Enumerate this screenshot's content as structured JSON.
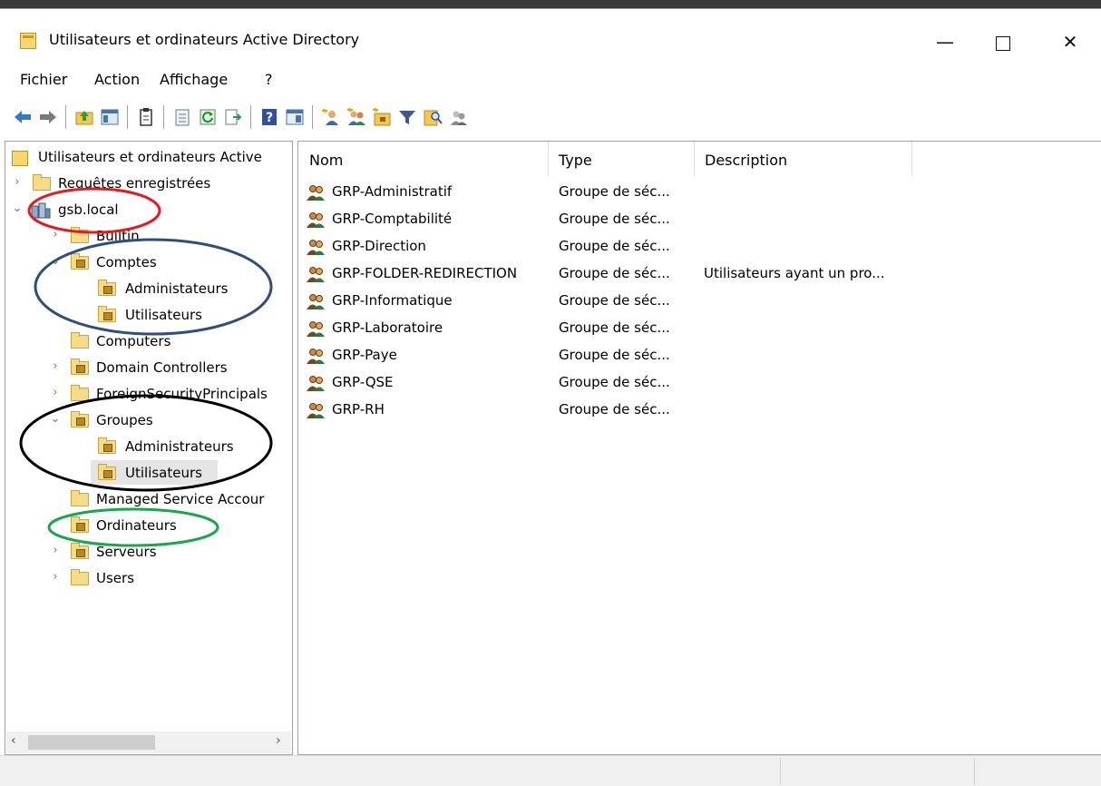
{
  "window": {
    "title": "Utilisateurs et ordinateurs Active Directory",
    "controls": {
      "minimize": "—",
      "close": "✕"
    }
  },
  "menu": [
    "Fichier",
    "Action",
    "Affichage",
    "?"
  ],
  "toolbar": {
    "icons": [
      "back-arrow-icon",
      "forward-arrow-icon",
      "up-folder-icon",
      "show-tree-icon",
      "properties-icon",
      "copy-icon",
      "refresh-icon",
      "export-list-icon",
      "help-icon",
      "console-view-icon",
      "new-user-icon",
      "new-group-icon",
      "new-ou-icon",
      "filter-icon",
      "find-icon",
      "add-to-group-icon"
    ]
  },
  "tree": {
    "root": "Utilisateurs et ordinateurs Active",
    "items": [
      {
        "label": "Requêtes enregistrées",
        "expander": "›"
      },
      {
        "label": "gsb.local",
        "expander": "⌄"
      },
      {
        "label": "Builtin",
        "expander": "›"
      },
      {
        "label": "Comptes",
        "expander": "⌄"
      },
      {
        "label": "Administateurs",
        "expander": ""
      },
      {
        "label": "Utilisateurs",
        "expander": ""
      },
      {
        "label": "Computers",
        "expander": ""
      },
      {
        "label": "Domain Controllers",
        "expander": "›"
      },
      {
        "label": "ForeignSecurityPrincipals",
        "expander": "›"
      },
      {
        "label": "Groupes",
        "expander": "⌄"
      },
      {
        "label": "Administrateurs",
        "expander": ""
      },
      {
        "label": "Utilisateurs",
        "expander": ""
      },
      {
        "label": "Managed Service Accour",
        "expander": ""
      },
      {
        "label": "Ordinateurs",
        "expander": ""
      },
      {
        "label": "Serveurs",
        "expander": "›"
      },
      {
        "label": "Users",
        "expander": "›"
      }
    ],
    "scroll": {
      "left": "‹",
      "right": "›"
    }
  },
  "list": {
    "columns": [
      "Nom",
      "Type",
      "Description"
    ],
    "rows": [
      {
        "name": "GRP-Administratif",
        "type": "Groupe de séc...",
        "description": ""
      },
      {
        "name": "GRP-Comptabilité",
        "type": "Groupe de séc...",
        "description": ""
      },
      {
        "name": "GRP-Direction",
        "type": "Groupe de séc...",
        "description": ""
      },
      {
        "name": "GRP-FOLDER-REDIRECTION",
        "type": "Groupe de séc...",
        "description": "Utilisateurs ayant un pro..."
      },
      {
        "name": "GRP-Informatique",
        "type": "Groupe de séc...",
        "description": ""
      },
      {
        "name": "GRP-Laboratoire",
        "type": "Groupe de séc...",
        "description": ""
      },
      {
        "name": "GRP-Paye",
        "type": "Groupe de séc...",
        "description": ""
      },
      {
        "name": "GRP-QSE",
        "type": "Groupe de séc...",
        "description": ""
      },
      {
        "name": "GRP-RH",
        "type": "Groupe de séc...",
        "description": ""
      }
    ]
  },
  "annotation_colors": {
    "red": "#e8191d",
    "blue": "#2e4f7e",
    "black": "#000000",
    "green": "#1aa64a"
  }
}
